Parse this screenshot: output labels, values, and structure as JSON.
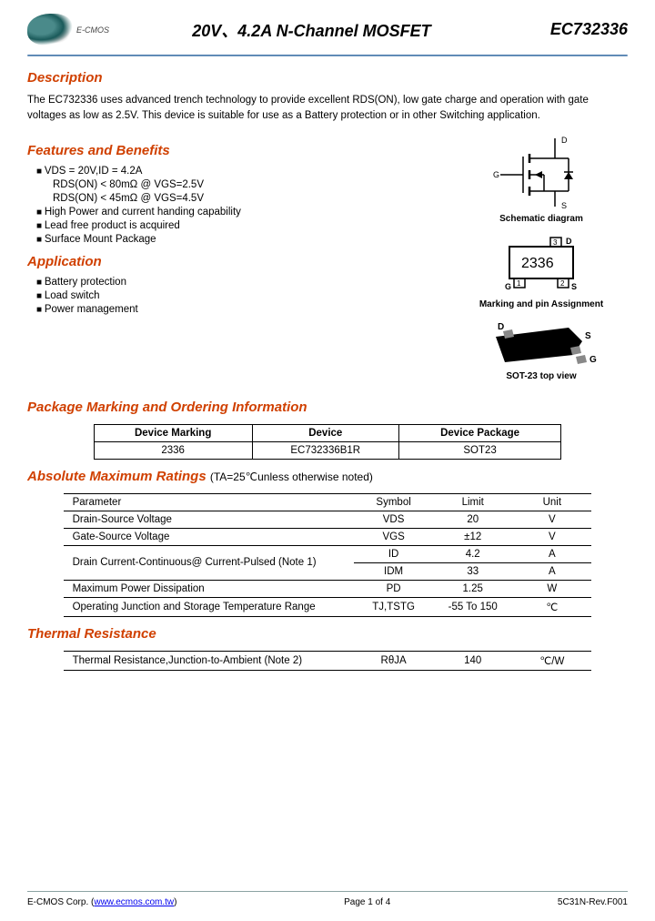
{
  "header": {
    "logo_text": "E-CMOS",
    "title": "20V、4.2A  N-Channel  MOSFET",
    "part_number": "EC732336"
  },
  "sections": {
    "description": {
      "title": "Description",
      "text": "The EC732336 uses advanced trench technology to provide excellent RDS(ON), low gate charge and operation with gate voltages as low as 2.5V. This device is suitable for use as a Battery protection or in other Switching application."
    },
    "features": {
      "title": "Features and Benefits",
      "items": [
        "VDS = 20V,ID = 4.2A",
        "RDS(ON) < 80mΩ @ VGS=2.5V",
        "RDS(ON) < 45mΩ @ VGS=4.5V",
        "High Power and current handing capability",
        "Lead free product is acquired",
        "Surface Mount Package"
      ]
    },
    "application": {
      "title": "Application",
      "items": [
        "Battery protection",
        "Load switch",
        "Power management"
      ]
    },
    "package_marking": {
      "title": "Package Marking and Ordering Information"
    },
    "absolute_max": {
      "title": "Absolute Maximum  Ratings ",
      "note": "(TA=25℃unless otherwise noted)"
    },
    "thermal": {
      "title": "Thermal Resistance"
    }
  },
  "diagrams": {
    "schematic_label": "Schematic diagram",
    "schematic_pins": {
      "d": "D",
      "g": "G",
      "s": "S"
    },
    "marking_label": "Marking and pin Assignment",
    "marking_code": "2336",
    "marking_pins": {
      "d": "D",
      "g": "G",
      "s": "S",
      "p1": "1",
      "p2": "2",
      "p3": "3"
    },
    "package_label": "SOT-23  top view",
    "package_pins": {
      "d": "D",
      "g": "G",
      "s": "S"
    }
  },
  "order_table": {
    "headers": [
      "Device Marking",
      "Device",
      "Device Package"
    ],
    "row": [
      "2336",
      "EC732336B1R",
      "SOT23"
    ]
  },
  "ratings_table": {
    "headers": [
      "Parameter",
      "Symbol",
      "Limit",
      "Unit"
    ],
    "rows": [
      {
        "param": "Drain-Source Voltage",
        "symbol": "VDS",
        "limit": "20",
        "unit": "V"
      },
      {
        "param": "Gate-Source Voltage",
        "symbol": "VGS",
        "limit": "±12",
        "unit": "V"
      },
      {
        "param": "Drain Current-Continuous@ Current-Pulsed (Note 1)",
        "symbol": "ID",
        "limit": "4.2",
        "unit": "A",
        "rowspan": 2
      },
      {
        "param": "",
        "symbol": "IDM",
        "limit": "33",
        "unit": "A"
      },
      {
        "param": "Maximum Power Dissipation",
        "symbol": "PD",
        "limit": "1.25",
        "unit": "W"
      },
      {
        "param": "Operating Junction and Storage Temperature Range",
        "symbol": "TJ,TSTG",
        "limit": "-55 To 150",
        "unit": "℃"
      }
    ]
  },
  "thermal_table": {
    "row": {
      "param": "Thermal Resistance,Junction-to-Ambient (Note 2)",
      "symbol": "RθJA",
      "limit": "140",
      "unit": "℃/W"
    }
  },
  "footer": {
    "left_prefix": "E-CMOS Corp. (",
    "url": "www.ecmos.com.tw",
    "left_suffix": ")",
    "center": "Page 1 of 4",
    "right": "5C31N-Rev.F001"
  }
}
